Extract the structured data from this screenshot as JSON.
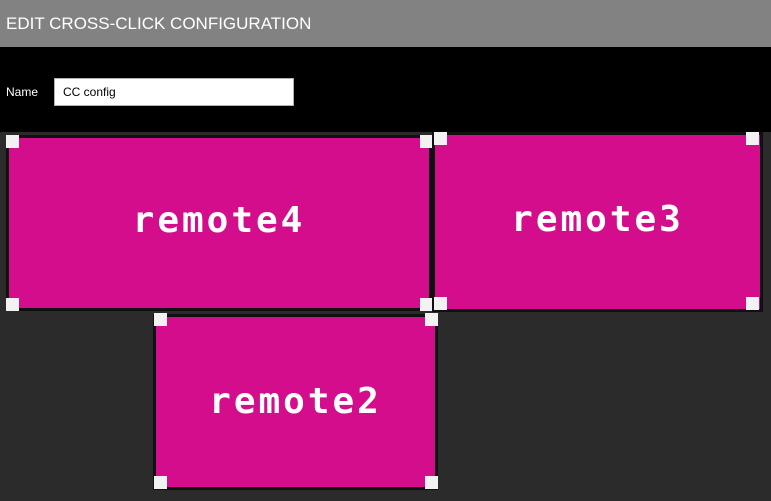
{
  "window": {
    "title": "EDIT CROSS-CLICK CONFIGURATION"
  },
  "form": {
    "name_label": "Name",
    "name_value": "CC config"
  },
  "remotes": [
    {
      "label": "remote4"
    },
    {
      "label": "remote3"
    },
    {
      "label": "remote2"
    }
  ],
  "colors": {
    "title_bar": "#828282",
    "header": "#000000",
    "canvas": "#2b2b2b",
    "remote_fill": "#d30d8c",
    "handle": "#f2f2f2"
  }
}
